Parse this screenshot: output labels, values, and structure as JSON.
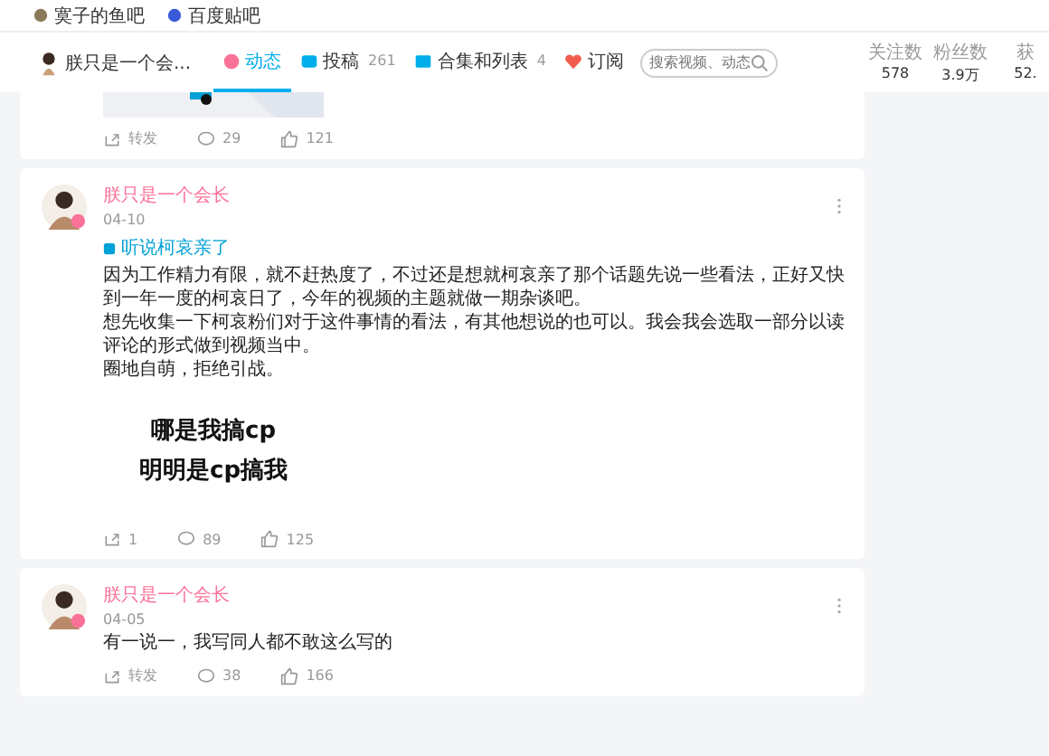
{
  "bookmarks": [
    {
      "label": "寞子的鱼吧"
    },
    {
      "label": "百度贴吧"
    }
  ],
  "nav": {
    "user_name": "朕只是一个会...",
    "tabs": [
      {
        "label": "动态",
        "selected": true,
        "kind": "feed"
      },
      {
        "label": "投稿",
        "count": "261",
        "selected": false,
        "kind": "video"
      },
      {
        "label": "合集和列表",
        "count": "4",
        "selected": false,
        "kind": "collection"
      },
      {
        "label": "订阅",
        "selected": false,
        "kind": "heart"
      }
    ],
    "search": {
      "placeholder": "搜索视频、动态"
    },
    "stats": [
      {
        "label": "关注数",
        "value": "578"
      },
      {
        "label": "粉丝数",
        "value": "3.9万"
      },
      {
        "label": "获",
        "value": "52."
      }
    ]
  },
  "posts": [
    {
      "partial": true,
      "kind": "picture",
      "actions": {
        "share": "转发",
        "comments": "29",
        "likes": "121"
      }
    },
    {
      "partial": false,
      "author": "朕只是一个会长",
      "date": "04-10",
      "topic": "听说柯哀亲了",
      "paragraphs": [
        "因为工作精力有限，就不赶热度了，不过还是想就柯哀亲了那个话题先说一些看法，正好又快到一年一度的柯哀日了，今年的视频的主题就做一期杂谈吧。",
        "想先收集一下柯哀粉们对于这件事情的看法，有其他想说的也可以。我会我会选取一部分以读评论的形式做到视频当中。",
        "圈地自萌，拒绝引战。"
      ],
      "kind": "text_image",
      "image_lines": [
        "哪是我搞cp",
        "明明是cp搞我"
      ],
      "actions": {
        "share": "1",
        "comments": "89",
        "likes": "125"
      }
    },
    {
      "partial": false,
      "author": "朕只是一个会长",
      "date": "04-05",
      "paragraphs": [
        "有一说一，我写同人都不敢这么写的"
      ],
      "kind": "none",
      "actions": {
        "share": "转发",
        "comments": "38",
        "likes": "166"
      }
    }
  ]
}
